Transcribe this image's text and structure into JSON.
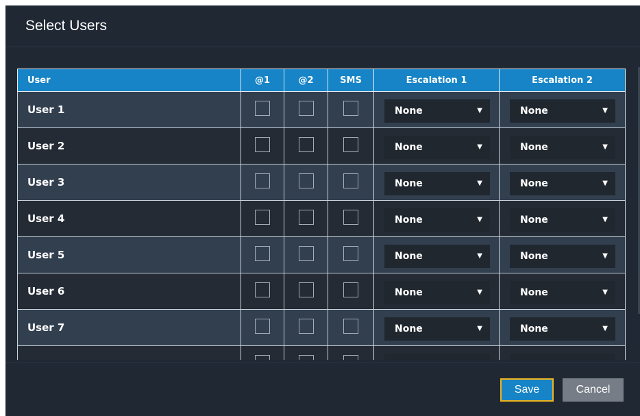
{
  "dialog": {
    "title": "Select Users"
  },
  "table": {
    "headers": {
      "user": "User",
      "at1": "@1",
      "at2": "@2",
      "sms": "SMS",
      "esc1": "Escalation 1",
      "esc2": "Escalation 2"
    },
    "rows": [
      {
        "name": "User 1",
        "at1": false,
        "at2": false,
        "sms": false,
        "esc1": "None",
        "esc2": "None"
      },
      {
        "name": "User 2",
        "at1": false,
        "at2": false,
        "sms": false,
        "esc1": "None",
        "esc2": "None"
      },
      {
        "name": "User 3",
        "at1": false,
        "at2": false,
        "sms": false,
        "esc1": "None",
        "esc2": "None"
      },
      {
        "name": "User 4",
        "at1": false,
        "at2": false,
        "sms": false,
        "esc1": "None",
        "esc2": "None"
      },
      {
        "name": "User 5",
        "at1": false,
        "at2": false,
        "sms": false,
        "esc1": "None",
        "esc2": "None"
      },
      {
        "name": "User 6",
        "at1": false,
        "at2": false,
        "sms": false,
        "esc1": "None",
        "esc2": "None"
      },
      {
        "name": "User 7",
        "at1": false,
        "at2": false,
        "sms": false,
        "esc1": "None",
        "esc2": "None"
      },
      {
        "name": "",
        "at1": false,
        "at2": false,
        "sms": false,
        "esc1": "",
        "esc2": ""
      }
    ]
  },
  "icons": {
    "dropdown": "triangle-down-icon",
    "dropdown_glyph": "▼"
  },
  "buttons": {
    "save": "Save",
    "cancel": "Cancel"
  },
  "colors": {
    "dialog_bg": "#202833",
    "header_blue": "#1684c6",
    "row_light": "#323f4f",
    "row_dark": "#242b35",
    "save_focus_border": "#f0b41c",
    "cancel_bg": "#767d86"
  }
}
